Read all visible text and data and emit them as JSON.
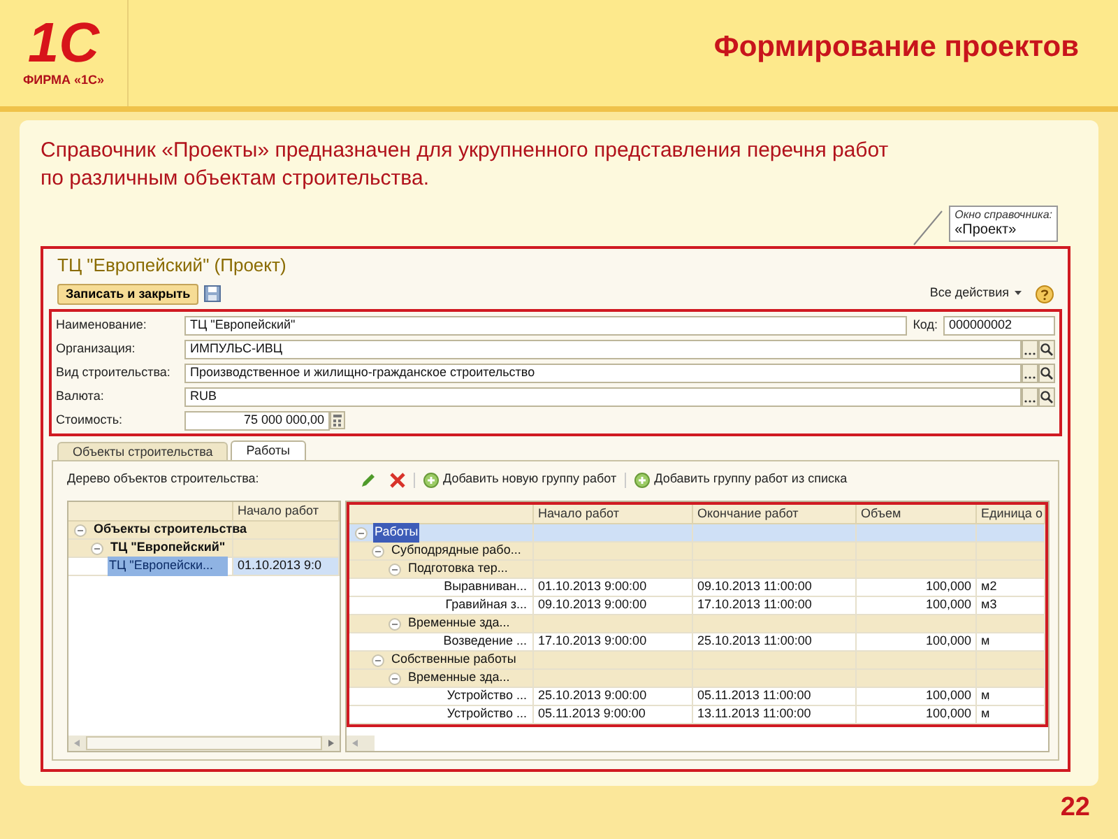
{
  "header": {
    "logo_mark": "1С",
    "logo_caption": "ФИРМА «1С»",
    "title": "Формирование проектов"
  },
  "description": "Справочник «Проекты»  предназначен для укрупненного представления перечня работ по различным объектам строительства.",
  "callout": {
    "line_1": "Окно справочника:",
    "line_2": "«Проект»"
  },
  "form": {
    "title": "ТЦ \"Европейский\" (Проект)",
    "save_button": "Записать и закрыть",
    "all_actions": "Все действия",
    "fields": [
      {
        "label": "Наименование:",
        "value": "ТЦ \"Европейский\"",
        "kind": "text"
      },
      {
        "label": "Организация:",
        "value": "ИМПУЛЬС-ИВЦ",
        "kind": "select"
      },
      {
        "label": "Вид строительства:",
        "value": "Производственное и жилищно-гражданское строительство",
        "kind": "select"
      },
      {
        "label": "Валюта:",
        "value": "RUB",
        "kind": "select"
      },
      {
        "label": "Стоимость:",
        "value": "75 000 000,00",
        "kind": "number"
      }
    ],
    "code": {
      "label": "Код:",
      "value": "000000002"
    },
    "tabs": [
      {
        "label": "Объекты строительства",
        "selected": false
      },
      {
        "label": "Работы",
        "selected": true
      }
    ],
    "tree_label": "Дерево объектов строительства:",
    "toolbar": [
      {
        "label": "Добавить новую группу работ"
      },
      {
        "label": "Добавить группу работ из списка"
      }
    ],
    "object_tree": {
      "columns": [
        "Начало работ"
      ],
      "rows": [
        {
          "name": "Объекты строительства",
          "selected": false,
          "expanded": true,
          "children": [
            {
              "name": "ТЦ \"Европейский\"",
              "selected": false,
              "expanded": true,
              "children": [
                {
                  "name": "ТЦ \"Европейски...",
                  "start": "01.10.2013 9:0",
                  "selected": true
                }
              ]
            }
          ]
        }
      ]
    },
    "works_table": {
      "columns": [
        "Начало работ",
        "Окончание работ",
        "Объем",
        "Единица о"
      ],
      "rows": [
        {
          "name": "Работы",
          "selected": true,
          "expanded": true,
          "children": [
            {
              "name": "Субподрядные рабо...",
              "selected": false,
              "expanded": true,
              "children": [
                {
                  "name": "Подготовка тер...",
                  "selected": false,
                  "expanded": true,
                  "children": [
                    {
                      "name": "Выравниван...",
                      "start": "01.10.2013 9:00:00",
                      "end": "09.10.2013 11:00:00",
                      "volume": "100,000",
                      "unit": "м2",
                      "selected": false
                    },
                    {
                      "name": "Гравийная з...",
                      "start": "09.10.2013 9:00:00",
                      "end": "17.10.2013 11:00:00",
                      "volume": "100,000",
                      "unit": "м3",
                      "selected": false
                    }
                  ]
                },
                {
                  "name": "Временные зда...",
                  "selected": false,
                  "expanded": true,
                  "children": [
                    {
                      "name": "Возведение ...",
                      "start": "17.10.2013 9:00:00",
                      "end": "25.10.2013 11:00:00",
                      "volume": "100,000",
                      "unit": "м",
                      "selected": false
                    }
                  ]
                }
              ]
            },
            {
              "name": "Собственные работы",
              "selected": false,
              "expanded": true,
              "children": [
                {
                  "name": "Временные зда...",
                  "selected": false,
                  "expanded": true,
                  "children": [
                    {
                      "name": "Устройство ...",
                      "start": "25.10.2013 9:00:00",
                      "end": "05.11.2013 11:00:00",
                      "volume": "100,000",
                      "unit": "м",
                      "selected": false
                    },
                    {
                      "name": "Устройство ...",
                      "start": "05.11.2013 9:00:00",
                      "end": "13.11.2013 11:00:00",
                      "volume": "100,000",
                      "unit": "м",
                      "selected": false
                    }
                  ]
                }
              ]
            }
          ]
        }
      ]
    }
  },
  "page_number": "22"
}
